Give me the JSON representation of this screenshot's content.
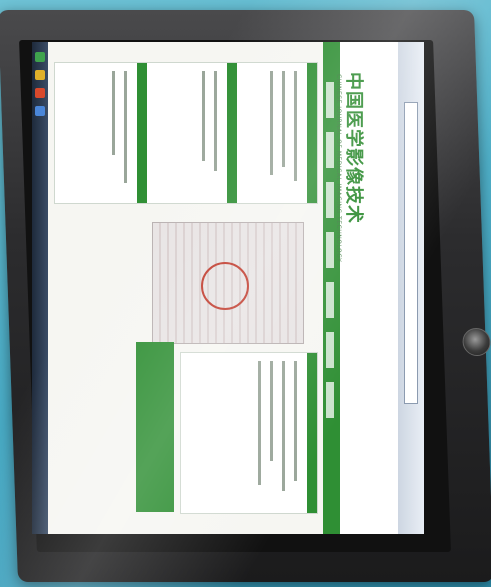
{
  "scene": {
    "subject": "monitor-displaying-website",
    "colors": {
      "background": "#4fb0c9",
      "bezel": "#2c2c2e",
      "site_green": "#2f8f34",
      "stamp_red": "#c0392b"
    }
  },
  "website": {
    "title": "中国医学影像技术",
    "subtitle": "CHINESE JOURNAL OF MEDICAL IMAGING TECHNOLOGY"
  },
  "icons": [
    "power-button-icon"
  ]
}
